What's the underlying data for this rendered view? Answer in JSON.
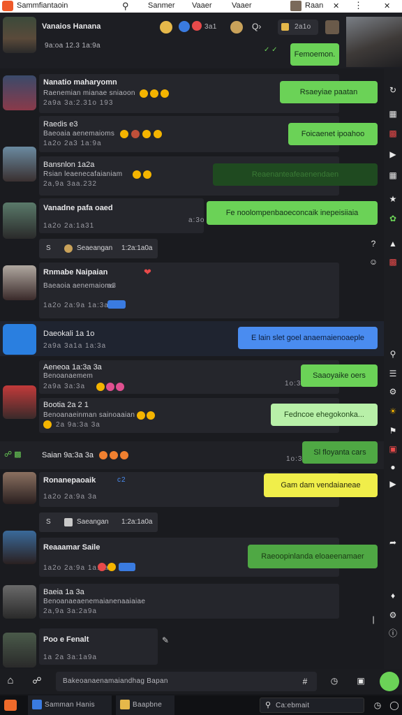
{
  "titlebar": {
    "app": "Sammfiantaoin",
    "tab1": "Sanmer",
    "tab2": "Vaaer",
    "tab3": "Vaaer",
    "tab4": "Raan"
  },
  "header": {
    "name": "Vanaios Hanana",
    "sub": "9a:oa 12.3 1a:9a",
    "pill": "2a1o",
    "ctrl": "3a1",
    "bubble": "Femoemon."
  },
  "messages": [
    {
      "name": "Nanatio maharyomn",
      "text": "Raenemian mianae sniaoon",
      "meta": "2a9a 3a:2.31o 193",
      "bubble": "Rsaeyiae paatan"
    },
    {
      "name": "Raedis e3",
      "text": "Baeoaia aenemaioms",
      "meta": "1a2o 2a3 1a:9a",
      "bubble": "Foicaenet ipoahoo"
    },
    {
      "name": "Bansnlon 1a2a",
      "text": "Rsian leaenecafaianiam",
      "meta": "2a,9a 3aa.232",
      "bubble": "Reaenanteafeaenendaen"
    },
    {
      "name": "Vanadne pafa oaed",
      "text": "",
      "meta": "1a2o 2a:1a31",
      "bubble": "Fe noolompenbaoeconcaik inepeisiiaia",
      "time": "a:3o"
    },
    {
      "name": "Seaeangan",
      "text": "",
      "meta": "1:2a:1a0a"
    },
    {
      "name": "Rnmabe Naipaian",
      "text": "Baeaoia aenemaioms",
      "meta": "1a2o 2a:9a 1a:3a",
      "extra": "a3"
    },
    {
      "name": "Daeokali 1a 1o",
      "text": "",
      "meta": "2a9a 3a1a 1a:3a",
      "bubble": "E lain slet goel anaemaienoaeple"
    },
    {
      "name": "Aeneoa 1a:3a 3a",
      "text": "Benoanaemem",
      "meta": "2a9a 3a:3a",
      "bubble": "Saaoyaike oers",
      "time": "1o:3"
    },
    {
      "name": "Bootia 2a 2 1",
      "text": "Benoanaeinman sainoaaian",
      "meta": "2a 9a:3a 3a",
      "bubble": "Fedncoe ehegokonka..."
    },
    {
      "name": "Saian 9a:3a 3a",
      "text": "",
      "meta": "",
      "bubble": "Sl floyanta cars",
      "time": "1o:3"
    },
    {
      "name": "Ronanepaoaik",
      "text": "",
      "meta": "1a2o 2a:9a 3a",
      "bubble": "Gam dam vendaianeae",
      "badge": "c2"
    },
    {
      "name": "Saeangan",
      "text": "",
      "meta": "1:2a:1a0a"
    },
    {
      "name": "Reaaamar Saile",
      "text": "",
      "meta": "1a2o 2a:9a 1a:3a",
      "bubble": "Raeoopinlanda eloaeenamaer"
    },
    {
      "name": "Baeia 1a 3a",
      "text": "Benoanaeaenemaianenaaiaiae",
      "meta": "2a,9a 3a:2a9a"
    },
    {
      "name": "Poo e Fenalt",
      "text": "",
      "meta": "1a 2a 3a:1a9a"
    }
  ],
  "composer": {
    "placeholder": "Bakeoanaenamaiandhag Bapan"
  },
  "taskbar": {
    "app1": "Samman Hanis",
    "app2": "Baapbne",
    "search": "Ca:ebmait"
  },
  "colors": {
    "accent_green": "#6bd257",
    "accent_blue": "#4a8cf0",
    "accent_yellow": "#f0ee4a",
    "bg": "#16171b"
  }
}
